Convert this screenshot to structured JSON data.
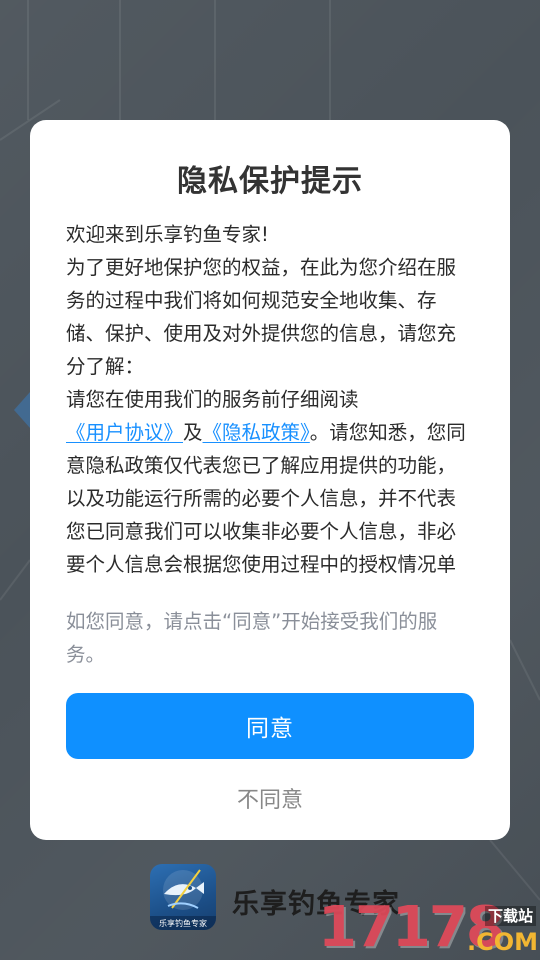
{
  "dialog": {
    "title": "隐私保护提示",
    "greeting": "欢迎来到乐享钓鱼专家!",
    "intro": "为了更好地保护您的权益，在此为您介绍在服务的过程中我们将如何规范安全地收集、存储、保护、使用及对外提供您的信息，请您充分了解：",
    "read_prefix": "请您在使用我们的服务前仔细阅读",
    "user_agreement_link": "《用户协议》",
    "and_text": "及",
    "privacy_policy_link": "《隐私政策》",
    "read_suffix": "。请您知悉，您同意隐私政策仅代表您已了解应用提供的功能，以及功能运行所需的必要个人信息，并不代表您已同意我们可以收集非必要个人信息，非必要个人信息会根据您使用过程中的授权情况单独征求",
    "hint": "如您同意，请点击“同意”开始接受我们的服务。",
    "agree_label": "同意",
    "disagree_label": "不同意"
  },
  "splash": {
    "app_name": "乐享钓鱼专家",
    "logo_caption": "乐享钓鱼专家"
  },
  "watermark": {
    "digits": "17178",
    "site_label": "下载站",
    "domain": ".COM"
  },
  "colors": {
    "accent": "#0f90ff",
    "link": "#1890ff",
    "background": "#4b535a",
    "watermark_red": "#e24a5a",
    "watermark_gold": "#f2b632"
  }
}
